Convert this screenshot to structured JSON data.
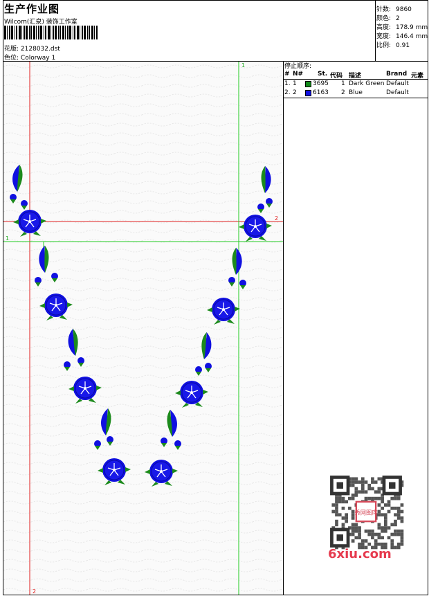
{
  "header": {
    "title": "生产作业图",
    "company": "Wilcom(汇泉) 装饰工作室",
    "design_label": "花版:",
    "design_value": "2128032.dst",
    "colorway_label": "色位:",
    "colorway_value": "Colorway 1"
  },
  "stats": [
    {
      "label": "针数:",
      "value": "9860"
    },
    {
      "label": "颜色:",
      "value": "2"
    },
    {
      "label": "高度:",
      "value": "178.9 mm"
    },
    {
      "label": "宽度:",
      "value": "146.4 mm"
    },
    {
      "label": "比例:",
      "value": "0.91"
    }
  ],
  "stop_sequence": {
    "title": "停止顺序:",
    "columns": [
      "#",
      "N#",
      "St.",
      "代码",
      "描述",
      "Brand",
      "元素"
    ],
    "rows": [
      {
        "idx": "1.",
        "n": "1",
        "color": "#128a1a",
        "st": "3695",
        "code": "1",
        "desc": "Dark Green",
        "brand": "Default"
      },
      {
        "idx": "2.",
        "n": "2",
        "color": "#1010e0",
        "st": "6163",
        "code": "2",
        "desc": "Blue",
        "brand": "Default"
      }
    ]
  },
  "guides": {
    "green_top": "1",
    "green_left": "1",
    "red_right": "2",
    "red_bottom": "2"
  },
  "watermark": {
    "text": "6xiu.com",
    "seal": "秀网图库"
  }
}
